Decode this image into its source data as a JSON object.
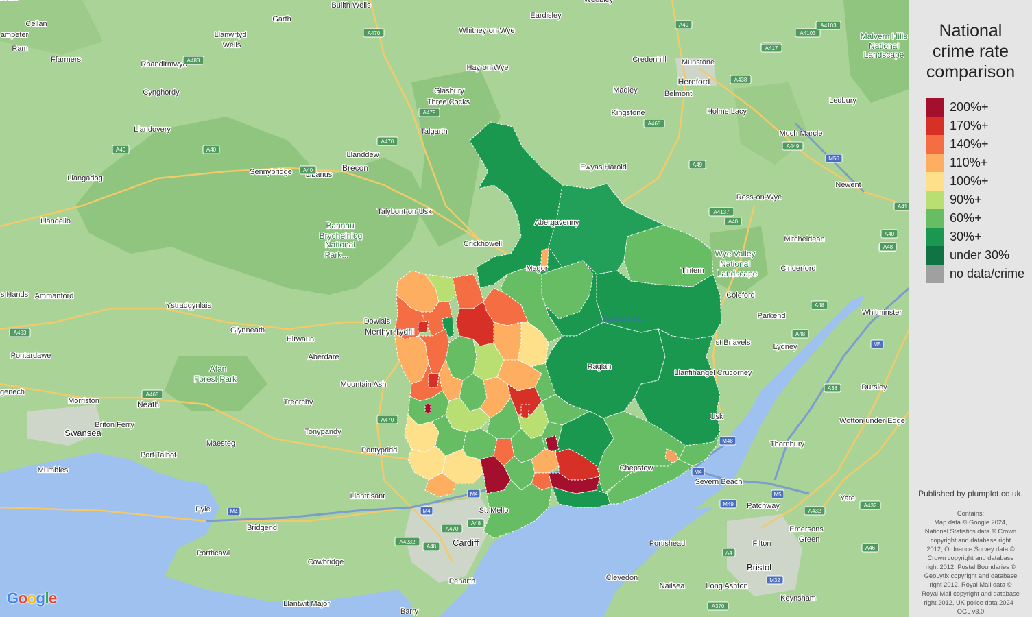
{
  "map": {
    "places": [
      {
        "name": "Builth Wells",
        "cls": "lbl"
      },
      {
        "name": "Cellan",
        "cls": "lbl"
      },
      {
        "name": "ampeter",
        "cls": "lbl"
      },
      {
        "name": "Ram",
        "cls": "lbl"
      },
      {
        "name": "Garth",
        "cls": "lbl"
      },
      {
        "name": "Llanwrtyd",
        "cls": "lbl"
      },
      {
        "name": "Wells",
        "cls": "lbl"
      },
      {
        "name": "Ffarmers",
        "cls": "lbl"
      },
      {
        "name": "Rhandirmwyn",
        "cls": "lbl"
      },
      {
        "name": "Cynghordy",
        "cls": "lbl"
      },
      {
        "name": "Llandovery",
        "cls": "lbl"
      },
      {
        "name": "Llangadog",
        "cls": "lbl"
      },
      {
        "name": "Llandeilo",
        "cls": "lbl"
      },
      {
        "name": "Sennybridge",
        "cls": "lbl"
      },
      {
        "name": "Libanus",
        "cls": "lbl"
      },
      {
        "name": "Brecon",
        "cls": "lbl big"
      },
      {
        "name": "Llanddew",
        "cls": "lbl"
      },
      {
        "name": "Talgarth",
        "cls": "lbl"
      },
      {
        "name": "Three Cocks",
        "cls": "lbl"
      },
      {
        "name": "Glasbury",
        "cls": "lbl"
      },
      {
        "name": "Hay-on-Wye",
        "cls": "lbl"
      },
      {
        "name": "Whitney-on-Wye",
        "cls": "lbl"
      },
      {
        "name": "Eardisley",
        "cls": "lbl"
      },
      {
        "name": "Weobley",
        "cls": "lbl"
      },
      {
        "name": "Credenhill",
        "cls": "lbl"
      },
      {
        "name": "Munstone",
        "cls": "lbl"
      },
      {
        "name": "Hereford",
        "cls": "lbl big"
      },
      {
        "name": "Belmont",
        "cls": "lbl"
      },
      {
        "name": "Madley",
        "cls": "lbl"
      },
      {
        "name": "Kingstone",
        "cls": "lbl"
      },
      {
        "name": "Holme Lacy",
        "cls": "lbl"
      },
      {
        "name": "Ledbury",
        "cls": "lbl"
      },
      {
        "name": "Much Marcle",
        "cls": "lbl"
      },
      {
        "name": "Ewyas Harold",
        "cls": "lbl"
      },
      {
        "name": "Newent",
        "cls": "lbl"
      },
      {
        "name": "Ross-on-Wye",
        "cls": "lbl"
      },
      {
        "name": "Mitcheldean",
        "cls": "lbl"
      },
      {
        "name": "Cinderford",
        "cls": "lbl"
      },
      {
        "name": "Coleford",
        "cls": "lbl"
      },
      {
        "name": "Parkend",
        "cls": "lbl"
      },
      {
        "name": "Lydney",
        "cls": "lbl"
      },
      {
        "name": "st Briavels",
        "cls": "lbl"
      },
      {
        "name": "Whitminster",
        "cls": "lbl"
      },
      {
        "name": "Dursley",
        "cls": "lbl"
      },
      {
        "name": "Wotton-under-Edge",
        "cls": "lbl"
      },
      {
        "name": "Thornbury",
        "cls": "lbl"
      },
      {
        "name": "Severn Beach",
        "cls": "lbl"
      },
      {
        "name": "Patchway",
        "cls": "lbl"
      },
      {
        "name": "Yate",
        "cls": "lbl"
      },
      {
        "name": "Filton",
        "cls": "lbl"
      },
      {
        "name": "Emersons",
        "cls": "lbl"
      },
      {
        "name": "Green",
        "cls": "lbl"
      },
      {
        "name": "Bristol",
        "cls": "lbl city"
      },
      {
        "name": "Portishead",
        "cls": "lbl"
      },
      {
        "name": "Clevedon",
        "cls": "lbl"
      },
      {
        "name": "Nailsea",
        "cls": "lbl"
      },
      {
        "name": "Long Ashton",
        "cls": "lbl"
      },
      {
        "name": "Keynsham",
        "cls": "lbl"
      },
      {
        "name": "Talybont-on-Usk",
        "cls": "lbl"
      },
      {
        "name": "Crickhowell",
        "cls": "lbl"
      },
      {
        "name": "Bannau",
        "cls": "lbl green"
      },
      {
        "name": "Brycheiniog",
        "cls": "lbl green"
      },
      {
        "name": "National",
        "cls": "lbl green"
      },
      {
        "name": "Park...",
        "cls": "lbl green"
      },
      {
        "name": "Ammanford",
        "cls": "lbl"
      },
      {
        "name": "s Hands",
        "cls": "lbl"
      },
      {
        "name": "Ystradgynlais",
        "cls": "lbl"
      },
      {
        "name": "Glynneath",
        "cls": "lbl"
      },
      {
        "name": "Hirwaun",
        "cls": "lbl"
      },
      {
        "name": "Dowlais",
        "cls": "lbl"
      },
      {
        "name": "Merthyr Tydfil",
        "cls": "lbl big"
      },
      {
        "name": "Aberdare",
        "cls": "lbl"
      },
      {
        "name": "Pontardawe",
        "cls": "lbl"
      },
      {
        "name": "genech",
        "cls": "lbl"
      },
      {
        "name": "Morriston",
        "cls": "lbl"
      },
      {
        "name": "Neath",
        "cls": "lbl big"
      },
      {
        "name": "Afan",
        "cls": "lbl green"
      },
      {
        "name": "Forest Park",
        "cls": "lbl green"
      },
      {
        "name": "Treorchy",
        "cls": "lbl"
      },
      {
        "name": "Mountain Ash",
        "cls": "lbl"
      },
      {
        "name": "Tonypandy",
        "cls": "lbl"
      },
      {
        "name": "Swansea",
        "cls": "lbl city"
      },
      {
        "name": "Briton Ferry",
        "cls": "lbl"
      },
      {
        "name": "Port Talbot",
        "cls": "lbl"
      },
      {
        "name": "Maesteg",
        "cls": "lbl"
      },
      {
        "name": "Pontypridd",
        "cls": "lbl"
      },
      {
        "name": "Mumbles",
        "cls": "lbl"
      },
      {
        "name": "Llantrisant",
        "cls": "lbl"
      },
      {
        "name": "Pyle",
        "cls": "lbl"
      },
      {
        "name": "Bridgend",
        "cls": "lbl"
      },
      {
        "name": "Porthcawl",
        "cls": "lbl"
      },
      {
        "name": "Cowbridge",
        "cls": "lbl"
      },
      {
        "name": "Cardiff",
        "cls": "lbl city"
      },
      {
        "name": "St. Mello",
        "cls": "lbl"
      },
      {
        "name": "Penarth",
        "cls": "lbl"
      },
      {
        "name": "Llantwit Major",
        "cls": "lbl"
      },
      {
        "name": "Barry",
        "cls": "lbl"
      },
      {
        "name": "Malvern Hills",
        "cls": "lbl green"
      },
      {
        "name": "National",
        "cls": "lbl green"
      },
      {
        "name": "Landscape",
        "cls": "lbl green"
      },
      {
        "name": "Wye Valley",
        "cls": "lbl green"
      },
      {
        "name": "National",
        "cls": "lbl green"
      },
      {
        "name": "Landscape",
        "cls": "lbl green"
      },
      {
        "name": "Swansea Bay",
        "cls": "lbl water"
      },
      {
        "name": "Raglan",
        "cls": "lbl"
      },
      {
        "name": "Usk",
        "cls": "lbl"
      },
      {
        "name": "Chepstow",
        "cls": "lbl"
      },
      {
        "name": "Magor",
        "cls": "lbl"
      },
      {
        "name": "Abergavenny",
        "cls": "lbl"
      },
      {
        "name": "Llanfihangel Crucorney",
        "cls": "lbl"
      },
      {
        "name": "Tintern",
        "cls": "lbl"
      },
      {
        "name": "Monmouth",
        "cls": "lbl"
      }
    ],
    "roads": [
      "A470",
      "A483",
      "A40",
      "A479",
      "A470",
      "A40",
      "A4103",
      "A417",
      "A49",
      "A438",
      "A465",
      "A449",
      "M50",
      "A49",
      "A4137",
      "A40",
      "A40",
      "A48",
      "A48",
      "A48",
      "M5",
      "A38",
      "M48",
      "M4",
      "M49",
      "A432",
      "A4",
      "M32",
      "A432",
      "A46",
      "A370",
      "A483",
      "A465",
      "A470",
      "M4",
      "M4",
      "A470",
      "A48",
      "A48",
      "A4232",
      "M4",
      "A40",
      "M5",
      "A4103",
      "A417",
      "A48",
      "A41"
    ],
    "attribution_logo": "Google"
  },
  "legend": {
    "title_lines": [
      "National",
      "crime rate",
      "comparison"
    ],
    "items": [
      {
        "label": "200%+",
        "color": "#a50f2e"
      },
      {
        "label": "170%+",
        "color": "#d73027"
      },
      {
        "label": "140%+",
        "color": "#f46d43"
      },
      {
        "label": "110%+",
        "color": "#fdae61"
      },
      {
        "label": "100%+",
        "color": "#fee08b"
      },
      {
        "label": "90%+",
        "color": "#b9df73"
      },
      {
        "label": "60%+",
        "color": "#66bd63"
      },
      {
        "label": "30%+",
        "color": "#1a9850"
      },
      {
        "label": "under 30%",
        "color": "#0f7343"
      },
      {
        "label": "no data/crime",
        "color": "#a0a0a0"
      }
    ]
  },
  "publisher": "Published by plumplot.co.uk.",
  "contains": "Contains:\nMap data © Google 2024,\nNational Statistics data © Crown\ncopyright and database right\n2012, Ordnance Survey data ©\nCrown copyright and database\nright 2012, Postal Boundaries ©\nGeoLytix copyright and database\nright 2012, Royal Mail data ©\nRoyal Mail copyright and database\nright 2012, UK police data 2024 -\nOGL v3.0"
}
